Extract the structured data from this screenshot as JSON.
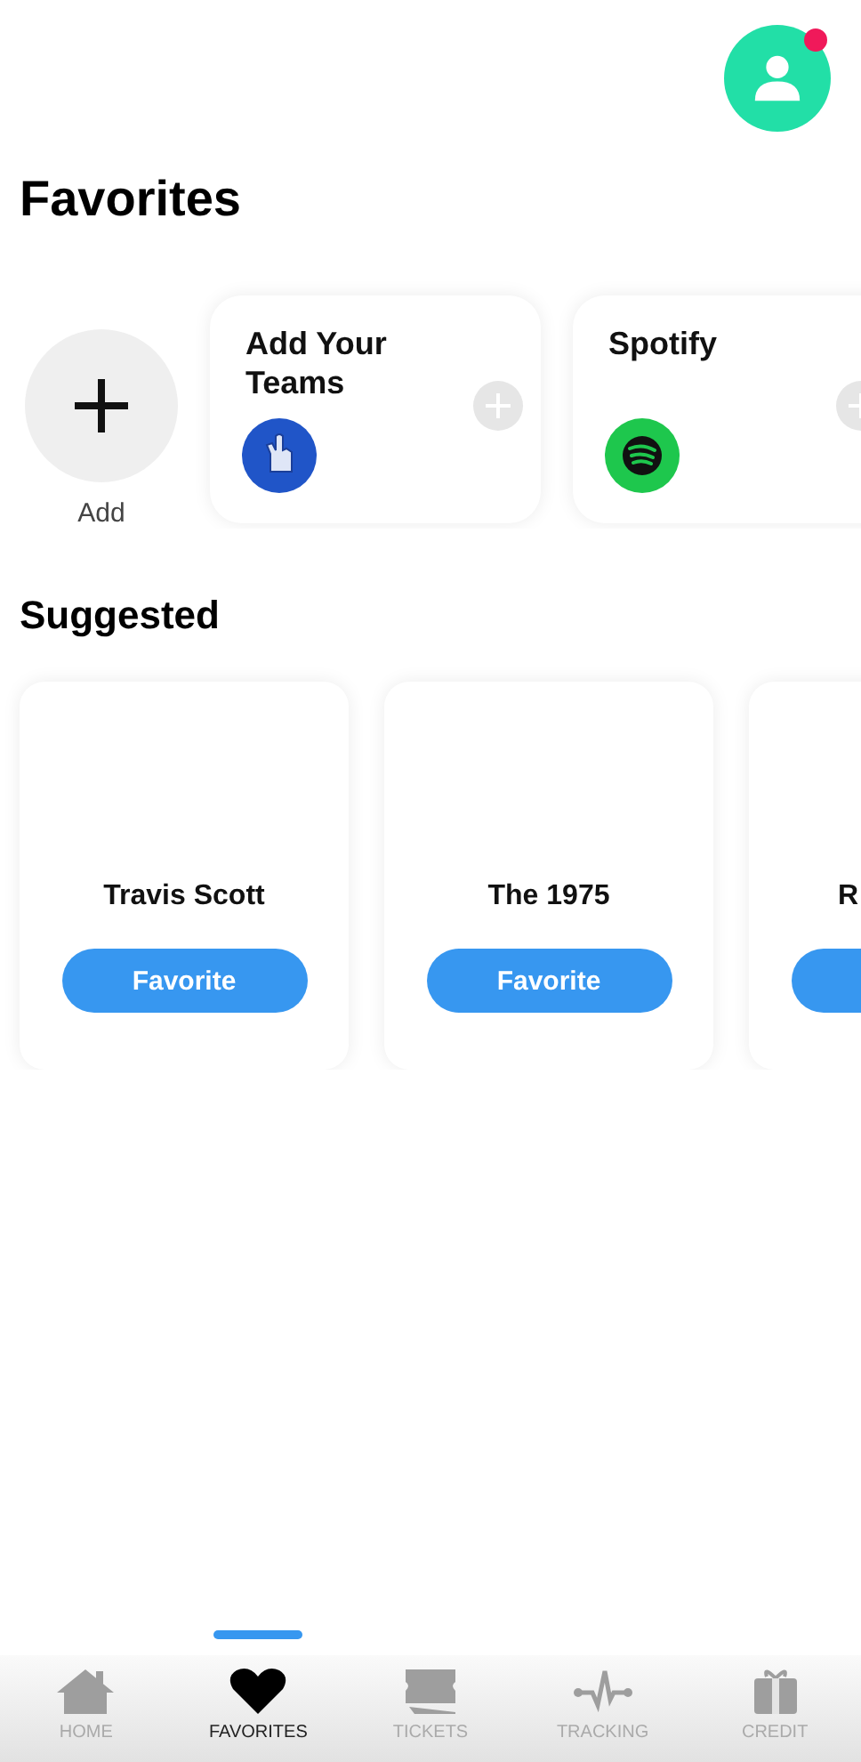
{
  "profile": {
    "notification": true
  },
  "favorites": {
    "title": "Favorites",
    "add_label": "Add",
    "cards": [
      {
        "title": "Add Your Teams",
        "kind": "teams"
      },
      {
        "title": "Spotify",
        "kind": "spotify"
      }
    ]
  },
  "suggested": {
    "title": "Suggested",
    "cards": [
      {
        "name": "Travis Scott",
        "button": "Favorite",
        "kind": "full"
      },
      {
        "name": "The 1975",
        "button": "Favorite",
        "kind": "full"
      },
      {
        "name": "R",
        "kind": "cut"
      }
    ]
  },
  "tabs": [
    {
      "label": "HOME",
      "kind": "home",
      "selected": false
    },
    {
      "label": "FAVORITES",
      "kind": "heart",
      "selected": true
    },
    {
      "label": "TICKETS",
      "kind": "ticket",
      "selected": false
    },
    {
      "label": "TRACKING",
      "kind": "pulse",
      "selected": false
    },
    {
      "label": "CREDIT",
      "kind": "gift",
      "selected": false
    }
  ]
}
